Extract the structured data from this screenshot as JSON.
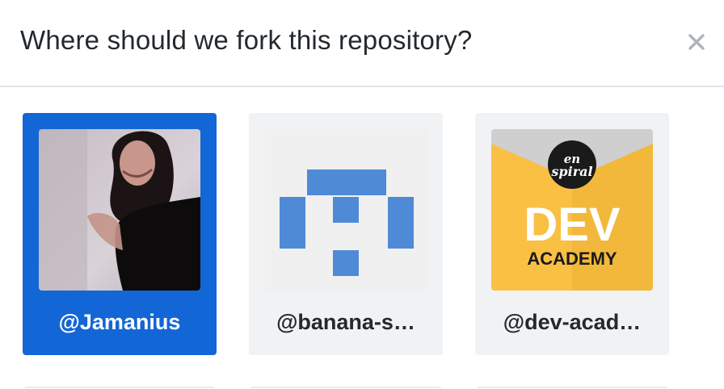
{
  "dialog": {
    "title": "Where should we fork this repository?",
    "close_icon": "close-icon"
  },
  "accounts": [
    {
      "handle": "@Jamanius",
      "avatar": "user-photo",
      "selected": true
    },
    {
      "handle": "@banana-s…",
      "avatar": "identicon",
      "selected": false
    },
    {
      "handle": "@dev-acad…",
      "avatar": "organization-logo",
      "selected": false,
      "logo": {
        "badge": "en spiral",
        "line1": "DEV",
        "line2": "ACADEMY"
      }
    }
  ],
  "colors": {
    "selected": "#1366d6",
    "card_bg": "#f1f2f3",
    "identicon": "#4f8ad6",
    "dev_academy_yellow": "#f9c043"
  }
}
